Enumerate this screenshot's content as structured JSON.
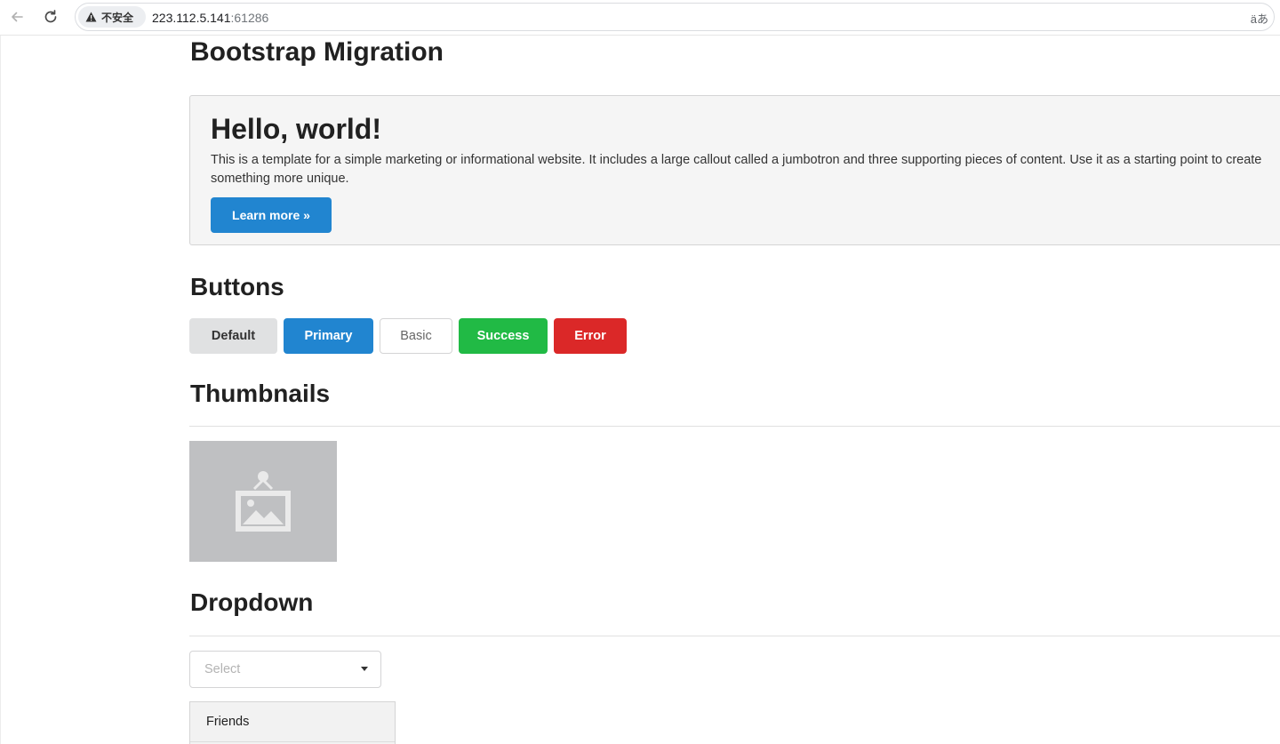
{
  "browser": {
    "security_label": "不安全",
    "url_host": "223.112.5.141",
    "url_port": ":61286",
    "translate_label": " äあ"
  },
  "page": {
    "title": "Bootstrap Migration",
    "jumbotron": {
      "heading": "Hello, world!",
      "text": "This is a template for a simple marketing or informational website. It includes a large callout called a jumbotron and three supporting pieces of content. Use it as a starting point to create something more unique.",
      "button_label": "Learn more »"
    },
    "buttons_section": {
      "heading": "Buttons",
      "buttons": {
        "default": "Default",
        "primary": "Primary",
        "basic": "Basic",
        "success": "Success",
        "error": "Error"
      }
    },
    "thumbnails_section": {
      "heading": "Thumbnails",
      "icon": "image-placeholder-icon"
    },
    "dropdown_section": {
      "heading": "Dropdown",
      "select_placeholder": "Select",
      "menu_items": [
        "Friends"
      ]
    }
  },
  "colors": {
    "primary": "#2185d0",
    "success": "#21ba45",
    "error": "#db2828",
    "default": "#e0e1e2",
    "jumbotron_bg": "#f5f5f5",
    "thumbnail_bg": "#bfc0c2"
  }
}
